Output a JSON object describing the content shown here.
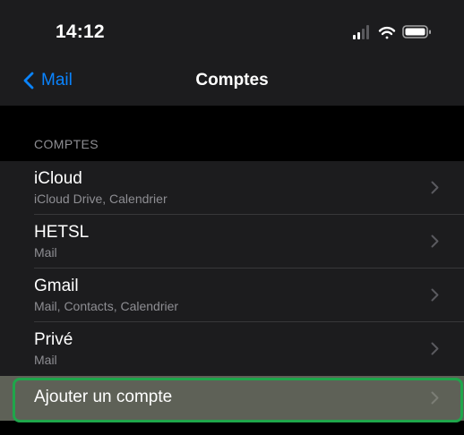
{
  "status_bar": {
    "time": "14:12",
    "icons": [
      "cellular-signal-icon",
      "wifi-icon",
      "battery-icon"
    ]
  },
  "nav": {
    "back_label": "Mail",
    "title": "Comptes"
  },
  "accounts_section": {
    "header": "COMPTES",
    "accounts": [
      {
        "name": "iCloud",
        "detail": "iCloud Drive, Calendrier"
      },
      {
        "name": "HETSL",
        "detail": "Mail"
      },
      {
        "name": "Gmail",
        "detail": "Mail, Contacts, Calendrier"
      },
      {
        "name": "Privé",
        "detail": "Mail"
      }
    ],
    "add_account_label": "Ajouter un compte"
  },
  "colors": {
    "background": "#000000",
    "grouped_row": "#1c1c1e",
    "accent_blue": "#0a84ff",
    "secondary_text": "#8e8e93",
    "highlight_row": "#5e6157",
    "highlight_border": "#1fa64b"
  }
}
